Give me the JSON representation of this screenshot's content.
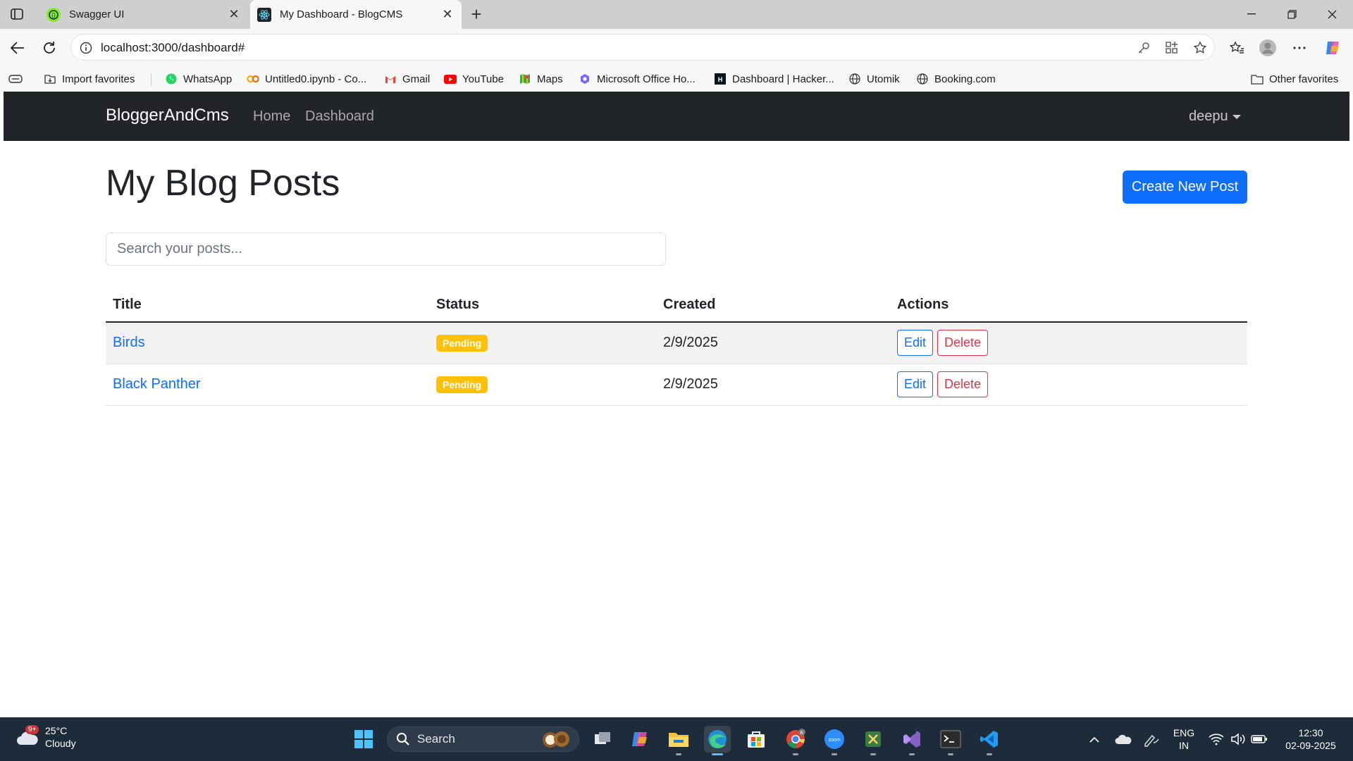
{
  "browser": {
    "tabs": [
      {
        "title": "Swagger UI",
        "active": false
      },
      {
        "title": "My Dashboard - BlogCMS",
        "active": true
      }
    ],
    "url": "localhost:3000/dashboard#",
    "favorites": [
      {
        "label": "Import favorites"
      },
      {
        "label": "WhatsApp"
      },
      {
        "label": "Untitled0.ipynb - Co..."
      },
      {
        "label": "Gmail"
      },
      {
        "label": "YouTube"
      },
      {
        "label": "Maps"
      },
      {
        "label": "Microsoft Office Ho..."
      },
      {
        "label": "Dashboard | Hacker..."
      },
      {
        "label": "Utomik"
      },
      {
        "label": "Booking.com"
      }
    ],
    "other_favorites": "Other favorites"
  },
  "app": {
    "brand": "BloggerAndCms",
    "nav": [
      {
        "label": "Home"
      },
      {
        "label": "Dashboard"
      }
    ],
    "user": "deepu",
    "page_title": "My Blog Posts",
    "create_button": "Create New Post",
    "search_placeholder": "Search your posts...",
    "table": {
      "headers": [
        "Title",
        "Status",
        "Created",
        "Actions"
      ],
      "rows": [
        {
          "title": "Birds",
          "status": "Pending",
          "created": "2/9/2025",
          "edit": "Edit",
          "delete": "Delete"
        },
        {
          "title": "Black Panther",
          "status": "Pending",
          "created": "2/9/2025",
          "edit": "Edit",
          "delete": "Delete"
        }
      ]
    },
    "colors": {
      "navbar": "#212529",
      "primary": "#0d6efd",
      "danger": "#dc3545",
      "warning": "#ffc107"
    }
  },
  "taskbar": {
    "weather": {
      "temp": "25°C",
      "desc": "Cloudy",
      "badge": "9+"
    },
    "search_label": "Search",
    "language": {
      "line1": "ENG",
      "line2": "IN"
    },
    "clock": {
      "time": "12:30",
      "date": "02-09-2025"
    },
    "apps": [
      "start-icon",
      "copilot-icon",
      "file-explorer-icon",
      "edge-icon",
      "store-icon",
      "chrome-icon",
      "zoom-icon",
      "snipping-icon",
      "visual-studio-icon",
      "terminal-icon",
      "vscode-icon"
    ]
  }
}
